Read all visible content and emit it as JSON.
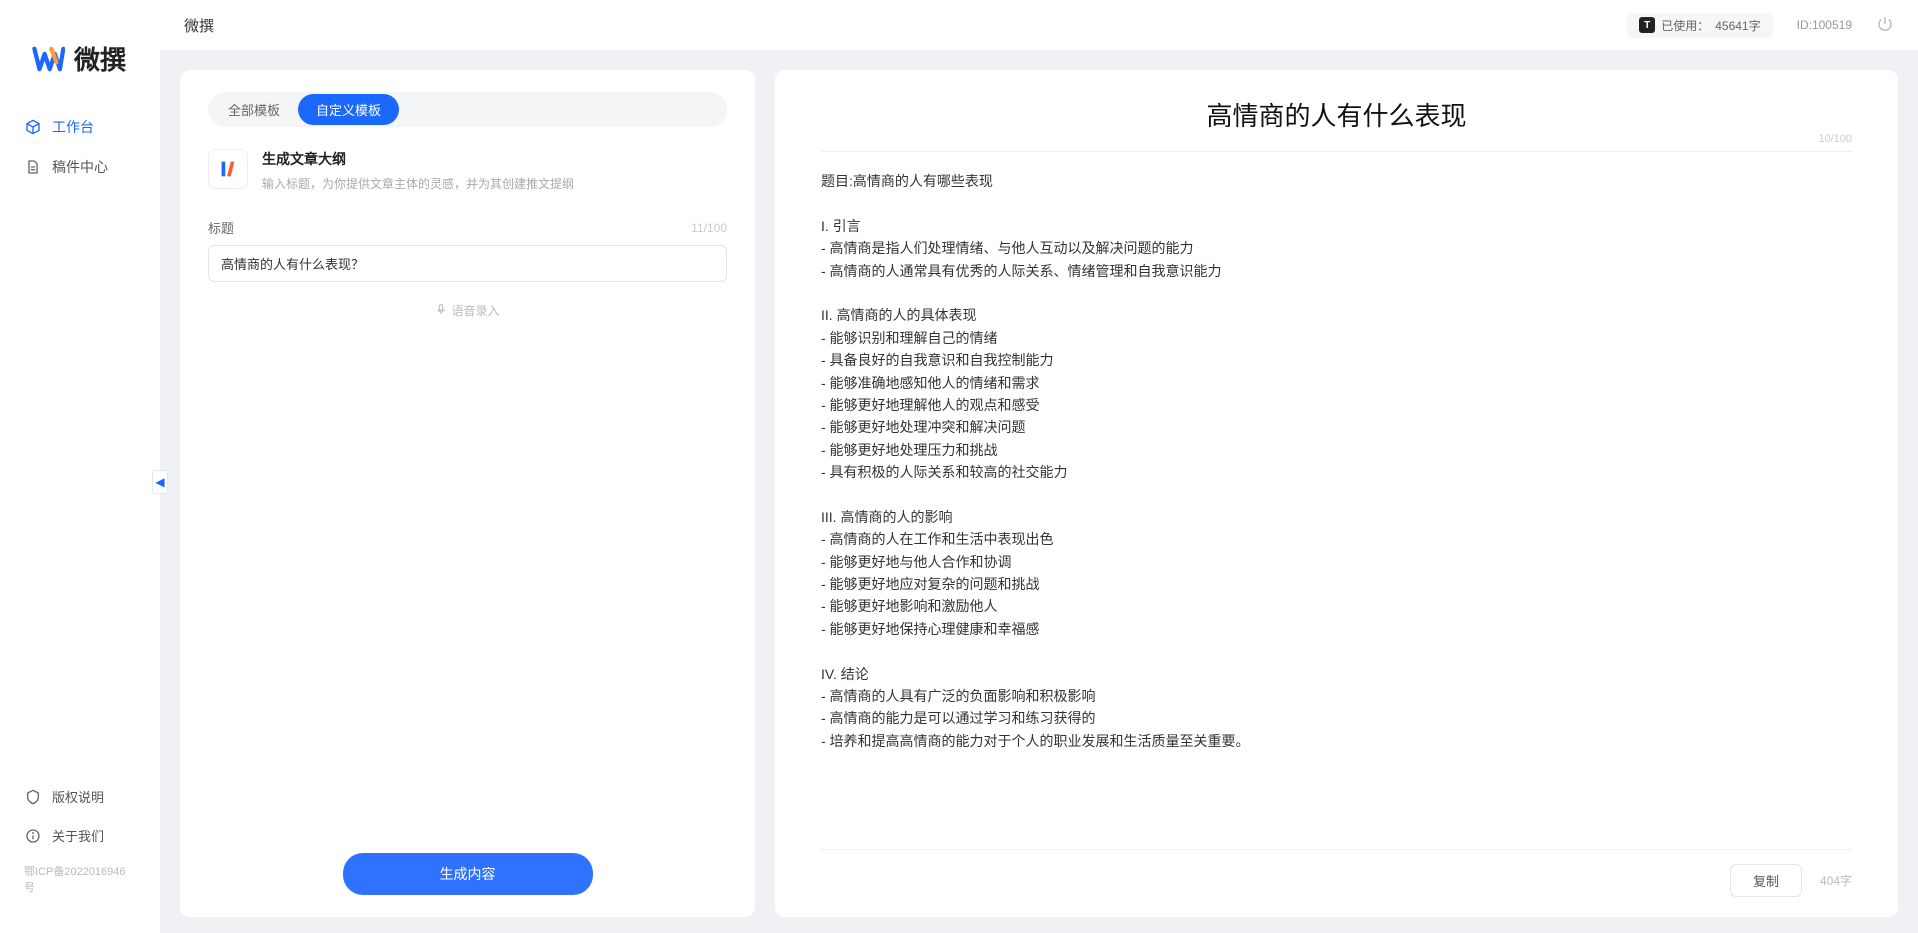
{
  "app": {
    "brand": "微撰",
    "topbar_title": "微撰"
  },
  "topbar": {
    "usage_prefix": "已使用：",
    "usage_value": "45641字",
    "user_id_label": "ID:",
    "user_id": "100519"
  },
  "sidebar": {
    "items": [
      {
        "label": "工作台",
        "icon": "workspace",
        "active": true
      },
      {
        "label": "稿件中心",
        "icon": "drafts",
        "active": false
      }
    ],
    "bottom": [
      {
        "label": "版权说明",
        "icon": "shield"
      },
      {
        "label": "关于我们",
        "icon": "info"
      }
    ],
    "icp": "鄂ICP备2022016946号"
  },
  "leftPanel": {
    "tabs": [
      {
        "label": "全部模板",
        "active": false
      },
      {
        "label": "自定义模板",
        "active": true
      }
    ],
    "template": {
      "title": "生成文章大纲",
      "desc": "输入标题，为你提供文章主体的灵感，并为其创建推文提纲"
    },
    "field_label": "标题",
    "char_counter": "11/100",
    "title_value": "高情商的人有什么表现？",
    "voice_hint": "语音录入",
    "generate_label": "生成内容"
  },
  "rightPanel": {
    "title": "高情商的人有什么表现",
    "title_counter": "10/100",
    "body": "题目:高情商的人有哪些表现\n\nI. 引言\n- 高情商是指人们处理情绪、与他人互动以及解决问题的能力\n- 高情商的人通常具有优秀的人际关系、情绪管理和自我意识能力\n\nII. 高情商的人的具体表现\n- 能够识别和理解自己的情绪\n- 具备良好的自我意识和自我控制能力\n- 能够准确地感知他人的情绪和需求\n- 能够更好地理解他人的观点和感受\n- 能够更好地处理冲突和解决问题\n- 能够更好地处理压力和挑战\n- 具有积极的人际关系和较高的社交能力\n\nIII. 高情商的人的影响\n- 高情商的人在工作和生活中表现出色\n- 能够更好地与他人合作和协调\n- 能够更好地应对复杂的问题和挑战\n- 能够更好地影响和激励他人\n- 能够更好地保持心理健康和幸福感\n\nIV. 结论\n- 高情商的人具有广泛的负面影响和积极影响\n- 高情商的能力是可以通过学习和练习获得的\n- 培养和提高高情商的能力对于个人的职业发展和生活质量至关重要。",
    "copy_label": "复制",
    "word_count": "404字"
  }
}
